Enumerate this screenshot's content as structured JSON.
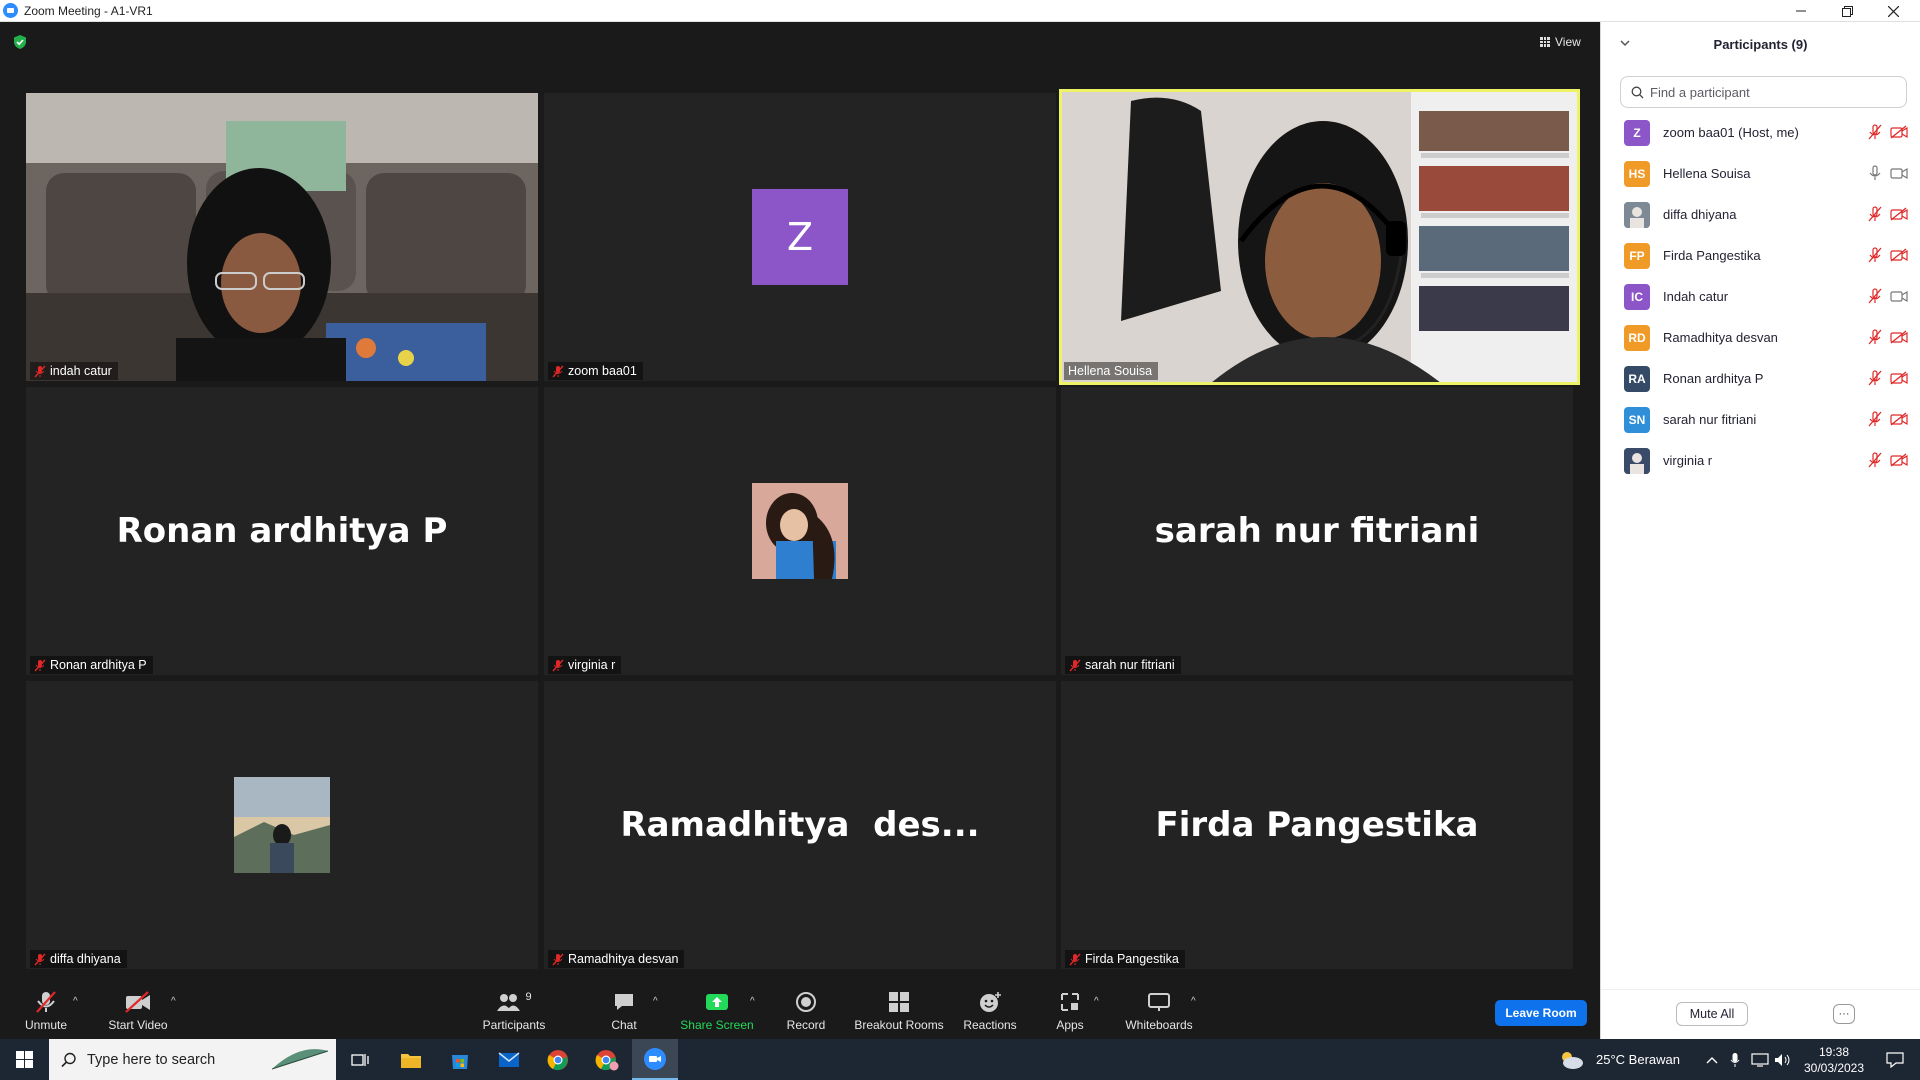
{
  "window": {
    "title": "Zoom Meeting - A1-VR1"
  },
  "meeting": {
    "view_label": "View",
    "tiles": [
      {
        "name": "indah catur",
        "type": "video-indah",
        "active": false,
        "muted": true
      },
      {
        "name": "zoom baa01",
        "type": "avatar-letter",
        "letter": "Z",
        "active": false,
        "muted": true
      },
      {
        "name": "Hellena Souisa",
        "type": "video-hellena",
        "active": true,
        "muted": false
      },
      {
        "name": "Ronan ardhitya P",
        "type": "name",
        "display": "Ronan ardhitya P",
        "active": false,
        "muted": true
      },
      {
        "name": "virginia r",
        "type": "photo-virginia",
        "active": false,
        "muted": true
      },
      {
        "name": "sarah nur fitriani",
        "type": "name",
        "display": "sarah nur fitriani",
        "active": false,
        "muted": true
      },
      {
        "name": "diffa dhiyana",
        "type": "photo-diffa",
        "active": false,
        "muted": true
      },
      {
        "name": "Ramadhitya desvan",
        "type": "name",
        "display": "Ramadhitya  des...",
        "active": false,
        "muted": true
      },
      {
        "name": "Firda Pangestika",
        "type": "name",
        "display": "Firda Pangestika",
        "active": false,
        "muted": true
      }
    ]
  },
  "toolbar": {
    "unmute": "Unmute",
    "start_video": "Start Video",
    "participants": "Participants",
    "participants_count": "9",
    "chat": "Chat",
    "share_screen": "Share Screen",
    "record": "Record",
    "breakout_rooms": "Breakout Rooms",
    "reactions": "Reactions",
    "apps": "Apps",
    "whiteboards": "Whiteboards",
    "leave": "Leave Room"
  },
  "panel": {
    "title": "Participants (9)",
    "search_placeholder": "Find a participant",
    "participants": [
      {
        "initials": "Z",
        "name": "zoom baa01 (Host, me)",
        "color": "#8c55c8",
        "mic": "off",
        "video": "off"
      },
      {
        "initials": "HS",
        "name": "Hellena Souisa",
        "color": "#f09a28",
        "mic": "on",
        "video": "on"
      },
      {
        "initials": "",
        "name": "diffa dhiyana",
        "color": "#7d8a96",
        "mic": "off",
        "video": "off",
        "photo": true
      },
      {
        "initials": "FP",
        "name": "Firda Pangestika",
        "color": "#f09a28",
        "mic": "off",
        "video": "off"
      },
      {
        "initials": "IC",
        "name": "Indah catur",
        "color": "#8c55c8",
        "mic": "off",
        "video": "on"
      },
      {
        "initials": "RD",
        "name": "Ramadhitya desvan",
        "color": "#f09a28",
        "mic": "off",
        "video": "off"
      },
      {
        "initials": "RA",
        "name": "Ronan ardhitya P",
        "color": "#344a66",
        "mic": "off",
        "video": "off"
      },
      {
        "initials": "SN",
        "name": "sarah nur fitriani",
        "color": "#2f8fd8",
        "mic": "off",
        "video": "off"
      },
      {
        "initials": "",
        "name": "virginia r",
        "color": "#3a4b6a",
        "mic": "off",
        "video": "off",
        "photo": true
      }
    ],
    "mute_all": "Mute All",
    "more": "···"
  },
  "taskbar": {
    "search_placeholder": "Type here to search",
    "weather": "25°C  Berawan",
    "time": "19:38",
    "date": "30/03/2023"
  },
  "colors": {
    "accent": "#0e72ed",
    "active_speaker": "#eef265",
    "muted": "#e02828",
    "share_green": "#23d959"
  }
}
